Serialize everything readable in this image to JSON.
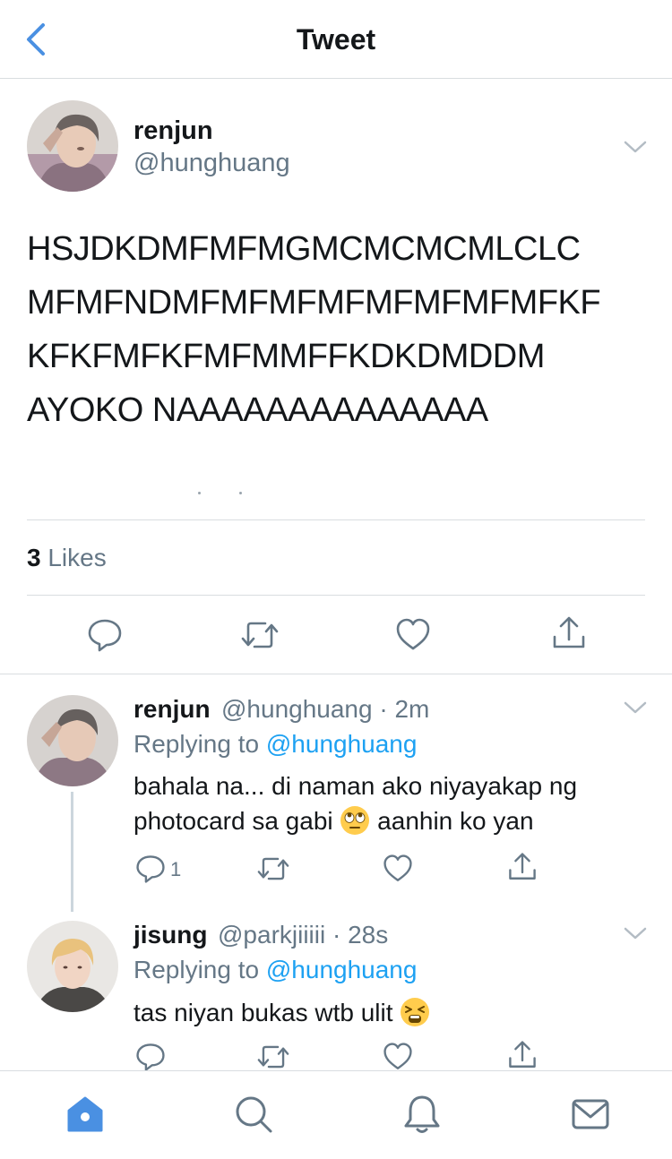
{
  "header": {
    "title": "Tweet"
  },
  "tweet": {
    "name": "renjun",
    "handle": "@hunghuang",
    "text_lines": [
      "HSJDKDMFMFMGMCMCMCMLCLC",
      "MFMFNDMFMFMFMFMFMFMFMFKF",
      "KFKFMFKFMFMMFFKDKDMDDM",
      "AYOKO NAAAAAAAAAAAAAA"
    ],
    "likes_count": "3",
    "likes_label": "Likes"
  },
  "replies": [
    {
      "name": "renjun",
      "meta": "@hunghuang · 2m",
      "replying_prefix": "Replying to ",
      "replying_handle": "@hunghuang",
      "text_before": "bahala na... di naman ako niyayakap ng photocard sa gabi ",
      "emoji": "face-with-rolling-eyes",
      "text_after": " aanhin ko yan",
      "reply_count": "1"
    },
    {
      "name": "jisung",
      "meta": "@parkjiiiii · 28s",
      "replying_prefix": "Replying to ",
      "replying_handle": "@hunghuang",
      "text_before": "tas niyan bukas wtb ulit ",
      "emoji": "tired-face",
      "text_after": "",
      "reply_count": ""
    }
  ],
  "tabbar": {
    "items": [
      "home",
      "search",
      "notifications",
      "messages"
    ],
    "active": "home"
  },
  "colors": {
    "accent": "#1da1f2",
    "text": "#14171a",
    "secondary": "#657786",
    "divider": "#d9dde0",
    "tab_active": "#4a90e2"
  }
}
